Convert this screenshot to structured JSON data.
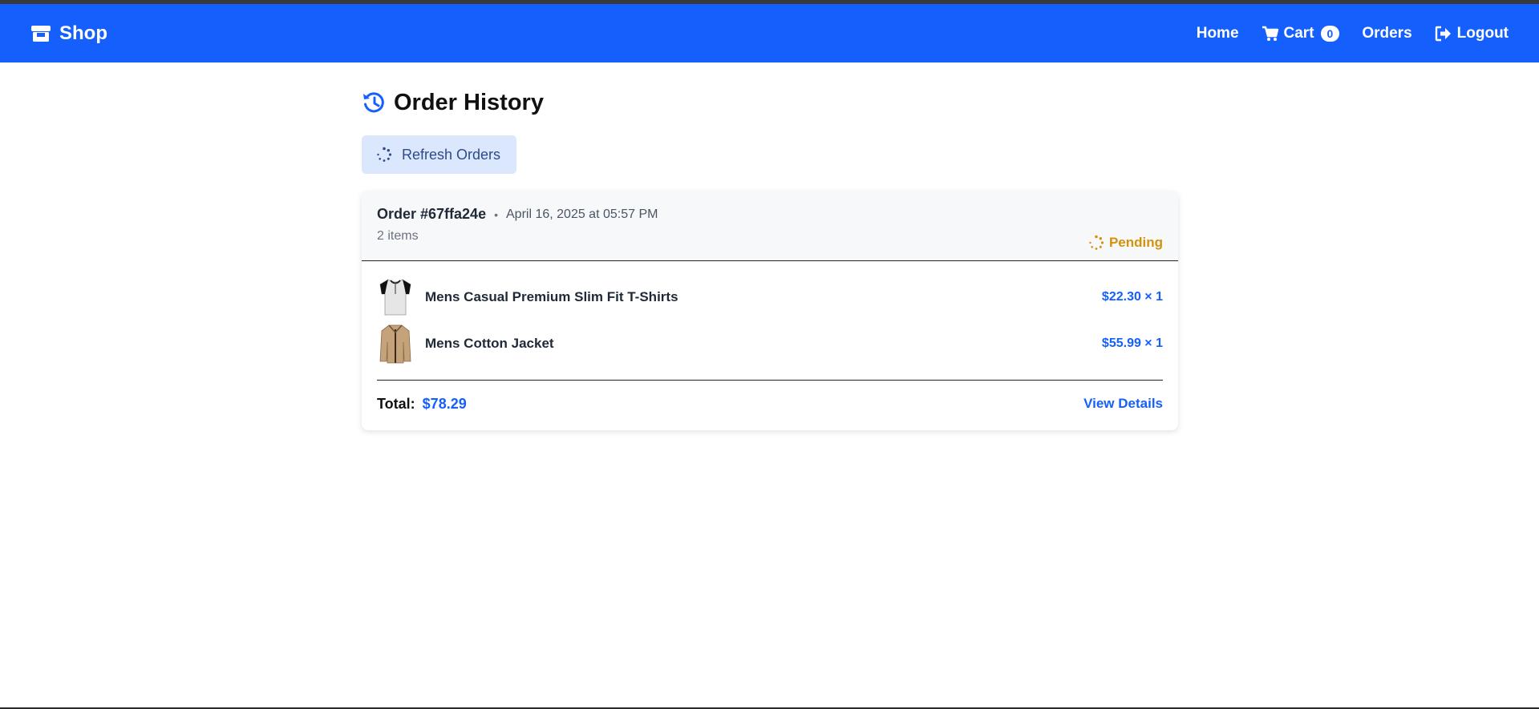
{
  "navbar": {
    "brand": "Shop",
    "links": {
      "home": "Home",
      "cart": "Cart",
      "cart_count": "0",
      "orders": "Orders",
      "logout": "Logout"
    }
  },
  "page": {
    "title": "Order History",
    "refresh_label": "Refresh Orders"
  },
  "order": {
    "id": "Order #67ffa24e",
    "date": "April 16, 2025 at 05:57 PM",
    "item_count": "2 items",
    "status": "Pending",
    "items": [
      {
        "name": "Mens Casual Premium Slim Fit T-Shirts",
        "price": "$22.30 × 1"
      },
      {
        "name": "Mens Cotton Jacket",
        "price": "$55.99 × 1"
      }
    ],
    "total_label": "Total:",
    "total_value": "$78.29",
    "view_details": "View Details"
  },
  "colors": {
    "primary": "#1560fc",
    "pending": "#d4920c",
    "button_bg": "#dbe7fd"
  }
}
